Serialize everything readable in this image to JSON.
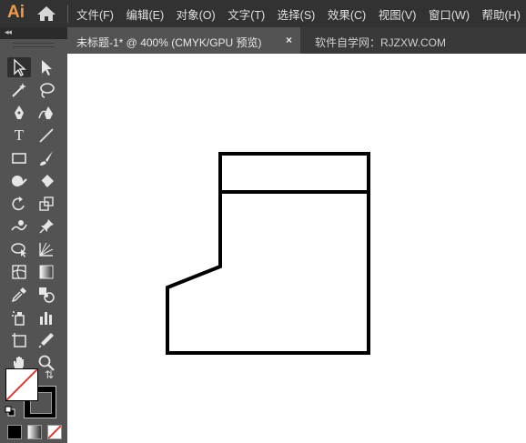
{
  "app": {
    "logo": "Ai"
  },
  "menu": [
    "文件(F)",
    "编辑(E)",
    "对象(O)",
    "文字(T)",
    "选择(S)",
    "效果(C)",
    "视图(V)",
    "窗口(W)",
    "帮助(H)"
  ],
  "tabs": {
    "active_title": "未标题-1* @ 400% (CMYK/GPU 预览)",
    "close_glyph": "×",
    "inactive_title": "软件自学网：RJZXW.COM"
  },
  "toolbox": {
    "collapse_glyph": "◂◂",
    "tools": [
      "selection-tool",
      "direct-selection-tool",
      "magic-wand-tool",
      "lasso-tool",
      "pen-tool",
      "curvature-tool",
      "type-tool",
      "line-segment-tool",
      "rectangle-tool",
      "paintbrush-tool",
      "shaper-tool",
      "eraser-tool",
      "rotate-tool",
      "scale-tool",
      "warp-tool",
      "puppet-warp-tool",
      "shape-builder-tool",
      "perspective-grid-tool",
      "mesh-tool",
      "gradient-tool",
      "eyedropper-tool",
      "blend-tool",
      "symbol-sprayer-tool",
      "column-graph-tool",
      "artboard-tool",
      "slice-tool",
      "hand-tool",
      "zoom-tool"
    ],
    "type_glyph": "T",
    "swap_glyph": "⇅",
    "fill": "none",
    "stroke": "#000000"
  },
  "colors": {
    "menubar": "#323232",
    "panel": "#535353",
    "logo": "#f29a4b",
    "canvas": "#ffffff",
    "artwork_stroke": "#000000"
  }
}
